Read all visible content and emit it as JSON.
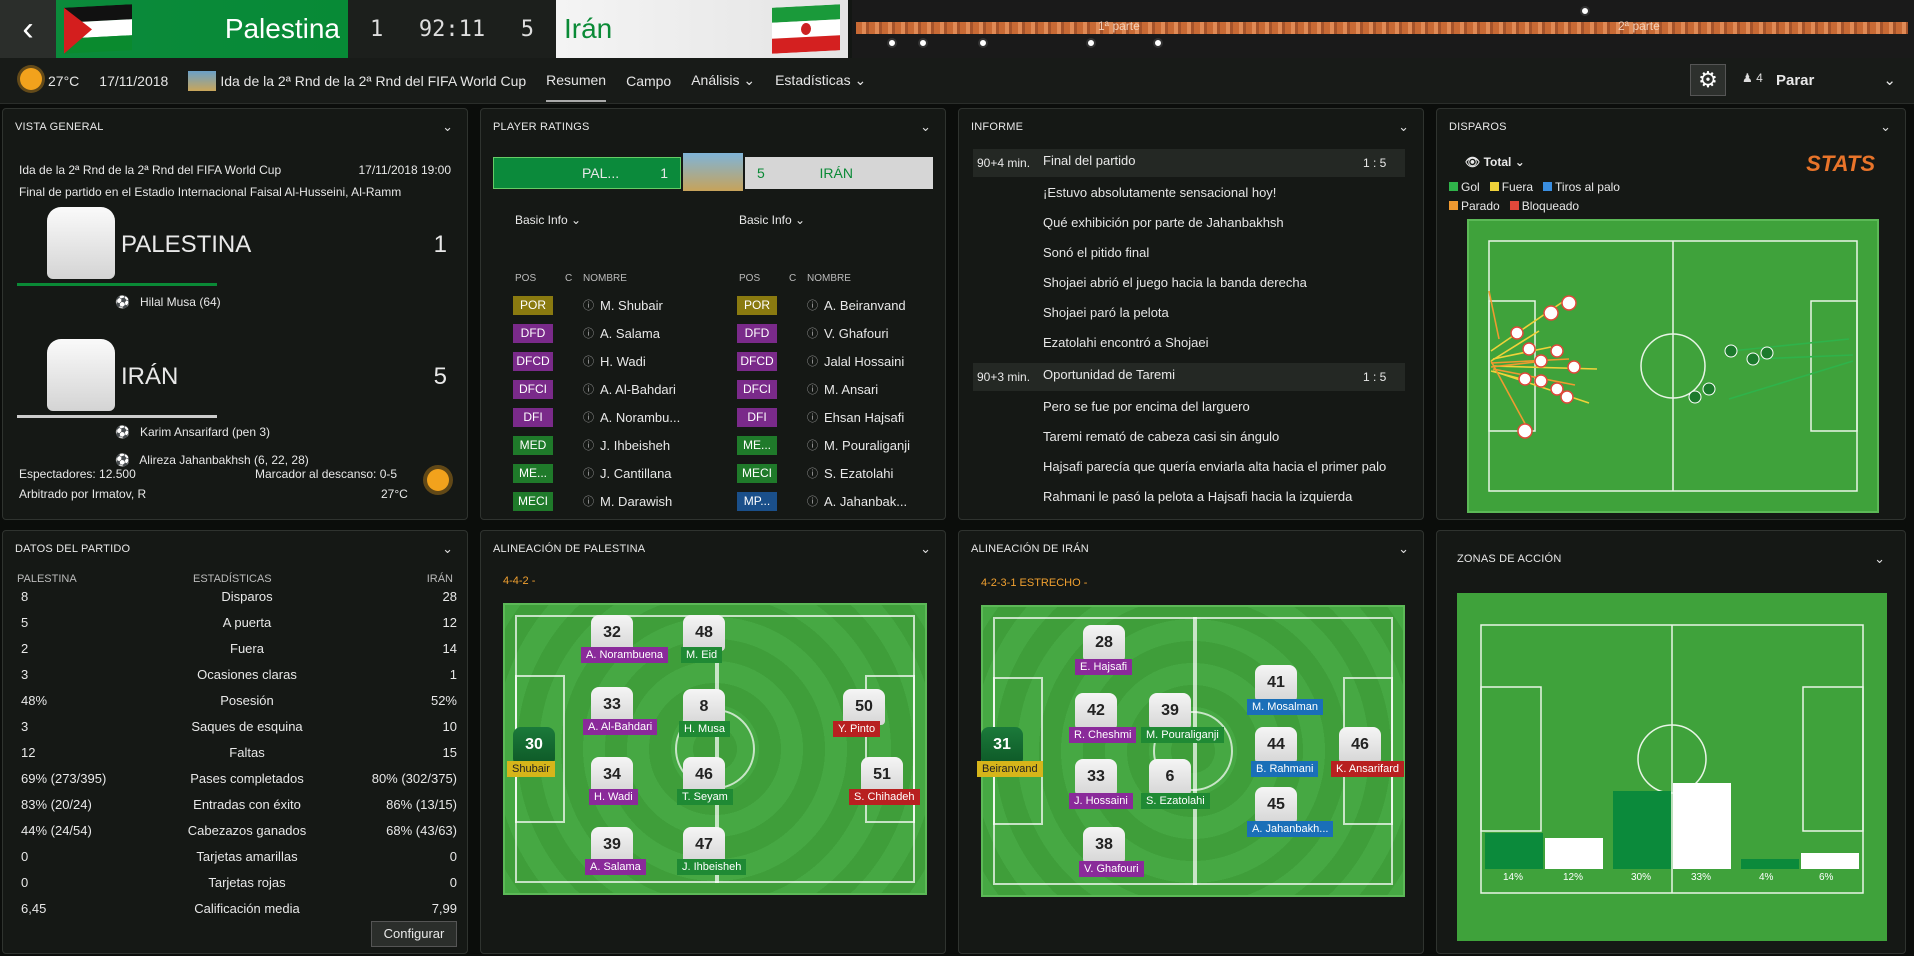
{
  "match": {
    "home_team": "Palestina",
    "away_team": "Irán",
    "home_score": "1",
    "away_score": "5",
    "clock": "92:11",
    "timeline_first": "1ª parte",
    "timeline_second": "2ª parte"
  },
  "nav": {
    "temperature": "27°C",
    "date": "17/11/2018",
    "competition": "Ida de la 2ª Rnd de la 2ª Rnd del FIFA World Cup",
    "tabs": [
      "Resumen",
      "Campo",
      "Análisis",
      "Estadísticas"
    ],
    "active_tab": "Resumen",
    "players_count": "4",
    "parar": "Parar"
  },
  "overview": {
    "title": "VISTA GENERAL",
    "competition": "Ida de la 2ª Rnd de la 2ª Rnd del FIFA World Cup",
    "datetime": "17/11/2018 19:00",
    "venue": "Final de partido en el Estadio Internacional Faisal Al-Husseini, Al-Ramm",
    "home_name": "PALESTINA",
    "home_score": "1",
    "home_scorers": [
      "Hilal Musa (64)"
    ],
    "away_name": "IRÁN",
    "away_score": "5",
    "away_scorers": [
      "Karim Ansarifard (pen 3)",
      "Alireza Jahanbakhsh (6, 22, 28)"
    ],
    "attendance": "Espectadores: 12.500",
    "halftime": "Marcador al descanso: 0-5",
    "referee": "Arbitrado por Irmatov, R",
    "temp": "27°C"
  },
  "ratings": {
    "title": "PLAYER RATINGS",
    "home_short": "PAL...",
    "home_score": "1",
    "away_short": "IRÁN",
    "away_score": "5",
    "filter": "Basic Info",
    "headers": [
      "POS",
      "C",
      "NOMBRE"
    ],
    "home_players": [
      {
        "pos": "POR",
        "name": "M. Shubair",
        "color": "#8a7a10"
      },
      {
        "pos": "DFD",
        "name": "A. Salama",
        "color": "#7a2a8a"
      },
      {
        "pos": "DFCD",
        "name": "H. Wadi",
        "color": "#7a2a8a"
      },
      {
        "pos": "DFCI",
        "name": "A. Al-Bahdari",
        "color": "#7a2a8a"
      },
      {
        "pos": "DFI",
        "name": "A. Norambu...",
        "color": "#7a2a8a"
      },
      {
        "pos": "MED",
        "name": "J. Ihbeisheh",
        "color": "#1f7a2a"
      },
      {
        "pos": "ME...",
        "name": "J. Cantillana",
        "color": "#1f7a2a"
      },
      {
        "pos": "MECI",
        "name": "M. Darawish",
        "color": "#1f7a2a"
      }
    ],
    "away_players": [
      {
        "pos": "POR",
        "name": "A. Beiranvand",
        "color": "#8a7a10"
      },
      {
        "pos": "DFD",
        "name": "V. Ghafouri",
        "color": "#7a2a8a"
      },
      {
        "pos": "DFCD",
        "name": "Jalal Hossaini",
        "color": "#7a2a8a"
      },
      {
        "pos": "DFCI",
        "name": "M. Ansari",
        "color": "#7a2a8a"
      },
      {
        "pos": "DFI",
        "name": "Ehsan Hajsafi",
        "color": "#7a2a8a"
      },
      {
        "pos": "ME...",
        "name": "M. Pouraliganji",
        "color": "#1f7a2a"
      },
      {
        "pos": "MECI",
        "name": "S. Ezatolahi",
        "color": "#1f7a2a"
      },
      {
        "pos": "MP...",
        "name": "A. Jahanbak...",
        "color": "#1a4f8a"
      }
    ]
  },
  "report": {
    "title": "INFORME",
    "blocks": [
      {
        "minute": "90+4 min.",
        "headline": "Final del partido",
        "score": "1 : 5",
        "lines": [
          "¡Estuvo absolutamente sensacional hoy!",
          "Qué exhibición por parte de Jahanbakhsh",
          "Sonó el pitido final",
          "Shojaei abrió el juego hacia la banda derecha",
          "Shojaei paró la pelota",
          "Ezatolahi encontró a Shojaei"
        ]
      },
      {
        "minute": "90+3 min.",
        "headline": "Oportunidad de Taremi",
        "score": "1 : 5",
        "lines": [
          "Pero se fue por encima del larguero",
          "Taremi remató de cabeza casi sin ángulo",
          "Hajsafi parecía que quería enviarla alta hacia el primer palo",
          "Rahmani le pasó la pelota a Hajsafi hacia la izquierda"
        ]
      }
    ]
  },
  "shots": {
    "title": "DISPAROS",
    "filter": "Total",
    "brand": "STATS",
    "legend": [
      {
        "label": "Gol",
        "color": "#2fb34a"
      },
      {
        "label": "Fuera",
        "color": "#f0d23a"
      },
      {
        "label": "Tiros al palo",
        "color": "#3a8ee0"
      },
      {
        "label": "Parado",
        "color": "#f09a30"
      },
      {
        "label": "Bloqueado",
        "color": "#e0483a"
      }
    ]
  },
  "match_data": {
    "title": "DATOS DEL PARTIDO",
    "col_home": "PALESTINA",
    "col_mid": "ESTADÍSTICAS",
    "col_away": "IRÁN",
    "rows": [
      {
        "home": "8",
        "label": "Disparos",
        "away": "28"
      },
      {
        "home": "5",
        "label": "A puerta",
        "away": "12"
      },
      {
        "home": "2",
        "label": "Fuera",
        "away": "14"
      },
      {
        "home": "3",
        "label": "Ocasiones claras",
        "away": "1"
      },
      {
        "home": "48%",
        "label": "Posesión",
        "away": "52%"
      },
      {
        "home": "3",
        "label": "Saques de esquina",
        "away": "10"
      },
      {
        "home": "12",
        "label": "Faltas",
        "away": "15"
      },
      {
        "home": "69% (273/395)",
        "label": "Pases completados",
        "away": "80% (302/375)"
      },
      {
        "home": "83% (20/24)",
        "label": "Entradas con éxito",
        "away": "86% (13/15)"
      },
      {
        "home": "44% (24/54)",
        "label": "Cabezazos ganados",
        "away": "68% (43/63)"
      },
      {
        "home": "0",
        "label": "Tarjetas amarillas",
        "away": "0"
      },
      {
        "home": "0",
        "label": "Tarjetas rojas",
        "away": "0"
      },
      {
        "home": "6,45",
        "label": "Calificación media",
        "away": "7,99"
      }
    ],
    "configure": "Configurar"
  },
  "home_lineup": {
    "title": "ALINEACIÓN DE PALESTINA",
    "formation": "4-4-2 -"
  },
  "away_lineup": {
    "title": "ALINEACIÓN DE IRÁN",
    "formation": "4-2-3-1 ESTRECHO -"
  },
  "zones": {
    "title": "ZONAS DE ACCIÓN",
    "values": [
      {
        "home": "14%",
        "away": "12%",
        "home_pct": 14,
        "away_pct": 12
      },
      {
        "home": "30%",
        "away": "33%",
        "home_pct": 30,
        "away_pct": 33
      },
      {
        "home": "4%",
        "away": "6%",
        "home_pct": 4,
        "away_pct": 6
      }
    ]
  }
}
